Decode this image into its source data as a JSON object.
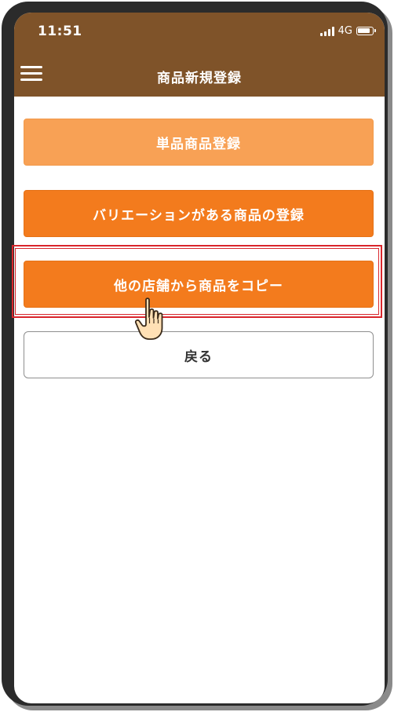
{
  "status_bar": {
    "time": "11:51",
    "network": "4G",
    "signal_icon": "signal-bars-icon",
    "battery_icon": "battery-icon"
  },
  "header": {
    "title": "商品新規登録",
    "menu_icon": "hamburger-menu-icon"
  },
  "buttons": {
    "single_product": "単品商品登録",
    "variation_product": "バリエーションがある商品の登録",
    "copy_from_store": "他の店舗から商品をコピー",
    "back": "戻る"
  },
  "overlay": {
    "pointer_icon": "pointing-hand-icon",
    "highlight_color": "#d9262c"
  },
  "colors": {
    "header_brown": "#7f5329",
    "primary_orange": "#f37b1d",
    "light_orange": "#f8a155"
  }
}
